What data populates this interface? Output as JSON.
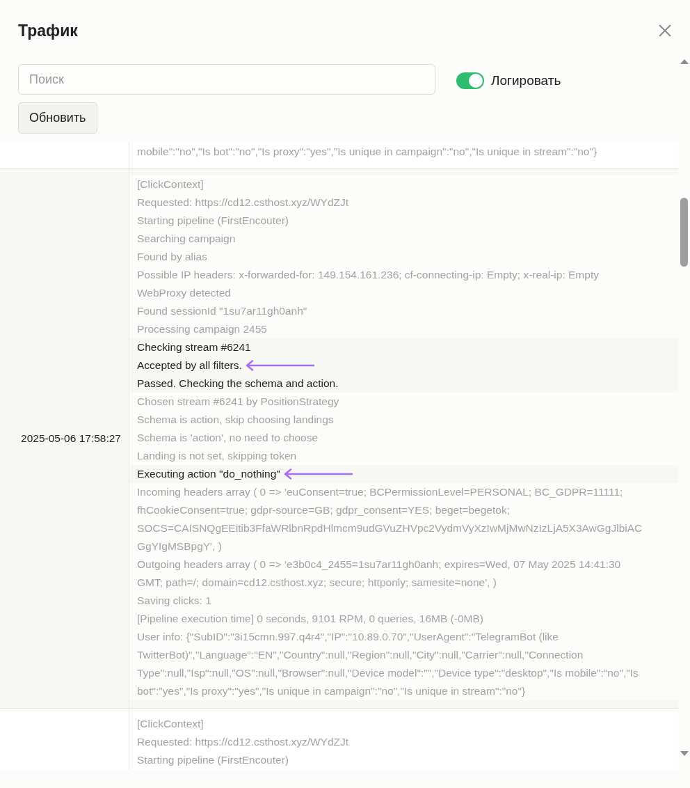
{
  "dialog": {
    "title": "Трафик"
  },
  "search": {
    "placeholder": "Поиск"
  },
  "logging_toggle": {
    "label": "Логировать",
    "on": true
  },
  "refresh_button": {
    "label": "Обновить"
  },
  "traffic_log": {
    "rows": [
      {
        "segments": [
          {
            "blurred": true,
            "lines": [
              {
                "text": "mobile\":\"no\",\"Is bot\":\"no\",\"Is proxy\":\"yes\",\"Is unique in campaign\":\"no\",\"Is unique in stream\":\"no\"}",
                "arrow": false
              }
            ]
          }
        ]
      },
      {
        "timestamp": "2025-05-06 17:58:27",
        "segments": [
          {
            "blurred": true,
            "lines": [
              {
                "text": "[ClickContext]",
                "arrow": false
              },
              {
                "text": "Requested: https://cd12.csthost.xyz/WYdZJt",
                "arrow": false
              },
              {
                "text": "Starting pipeline (FirstEncouter)",
                "arrow": false
              },
              {
                "text": "Searching campaign",
                "arrow": false
              },
              {
                "text": "Found by alias",
                "arrow": false
              },
              {
                "text": "Possible IP headers: x-forwarded-for: 149.154.161.236; cf-connecting-ip: Empty; x-real-ip: Empty",
                "arrow": false
              },
              {
                "text": "WebProxy detected",
                "arrow": false
              },
              {
                "text": "Found sessionId \"1su7ar11gh0anh\"",
                "arrow": false
              },
              {
                "text": "Processing campaign 2455",
                "arrow": false
              }
            ]
          },
          {
            "blurred": false,
            "lines": [
              {
                "text": "Checking stream #6241",
                "arrow": false
              },
              {
                "text": "Accepted by all filters.",
                "arrow": true
              },
              {
                "text": "Passed. Checking the schema and action.",
                "arrow": false
              }
            ]
          },
          {
            "blurred": true,
            "lines": [
              {
                "text": "Chosen stream #6241 by PositionStrategy",
                "arrow": false
              },
              {
                "text": "Schema is action, skip choosing landings",
                "arrow": false
              },
              {
                "text": "Schema is 'action', no need to choose",
                "arrow": false
              },
              {
                "text": "Landing is not set, skipping token",
                "arrow": false
              }
            ]
          },
          {
            "blurred": false,
            "lines": [
              {
                "text": "Executing action \"do_nothing\"",
                "arrow": true
              }
            ]
          },
          {
            "blurred": true,
            "lines": [
              {
                "text": "Incoming headers array ( 0 => 'euConsent=true; BCPermissionLevel=PERSONAL; BC_GDPR=11111; fhCookieConsent=true; gdpr-source=GB; gdpr_consent=YES; beget=begetok; SOCS=CAISNQgEEitib3FfaWRlbnRpdHlmcm9udGVuZHVpc2VydmVyXzIwMjMwNzIzLjA5X3AwGgJlbiACGgYIgMSBpgY', )",
                "arrow": false
              },
              {
                "text": "Outgoing headers array ( 0 => 'e3b0c4_2455=1su7ar11gh0anh; expires=Wed, 07 May 2025 14:41:30 GMT; path=/; domain=cd12.csthost.xyz; secure; httponly; samesite=none', )",
                "arrow": false
              },
              {
                "text": "Saving clicks: 1",
                "arrow": false
              },
              {
                "text": "[Pipeline execution time] 0 seconds, 9101 RPM, 0 queries, 16MB (-0MB)",
                "arrow": false
              },
              {
                "text": "User info: {\"SubID\":\"3i15cmn.997.q4r4\",\"IP\":\"10.89.0.70\",\"UserAgent\":\"TelegramBot (like TwitterBot)\",\"Language\":\"EN\",\"Country\":null,\"Region\":null,\"City\":null,\"Carrier\":null,\"Connection Type\":null,\"Isp\":null,\"OS\":null,\"Browser\":null,\"Device model\":\"\",\"Device type\":\"desktop\",\"Is mobile\":\"no\",\"Is bot\":\"yes\",\"Is proxy\":\"yes\",\"Is unique in campaign\":\"no\",\"Is unique in stream\":\"no\"}",
                "arrow": false
              }
            ]
          }
        ]
      },
      {
        "segments": [
          {
            "blurred": true,
            "lines": [
              {
                "text": "[ClickContext]",
                "arrow": false
              },
              {
                "text": "Requested: https://cd12.csthost.xyz/WYdZJt",
                "arrow": false
              },
              {
                "text": "Starting pipeline (FirstEncouter)",
                "arrow": false
              }
            ]
          }
        ]
      }
    ]
  }
}
